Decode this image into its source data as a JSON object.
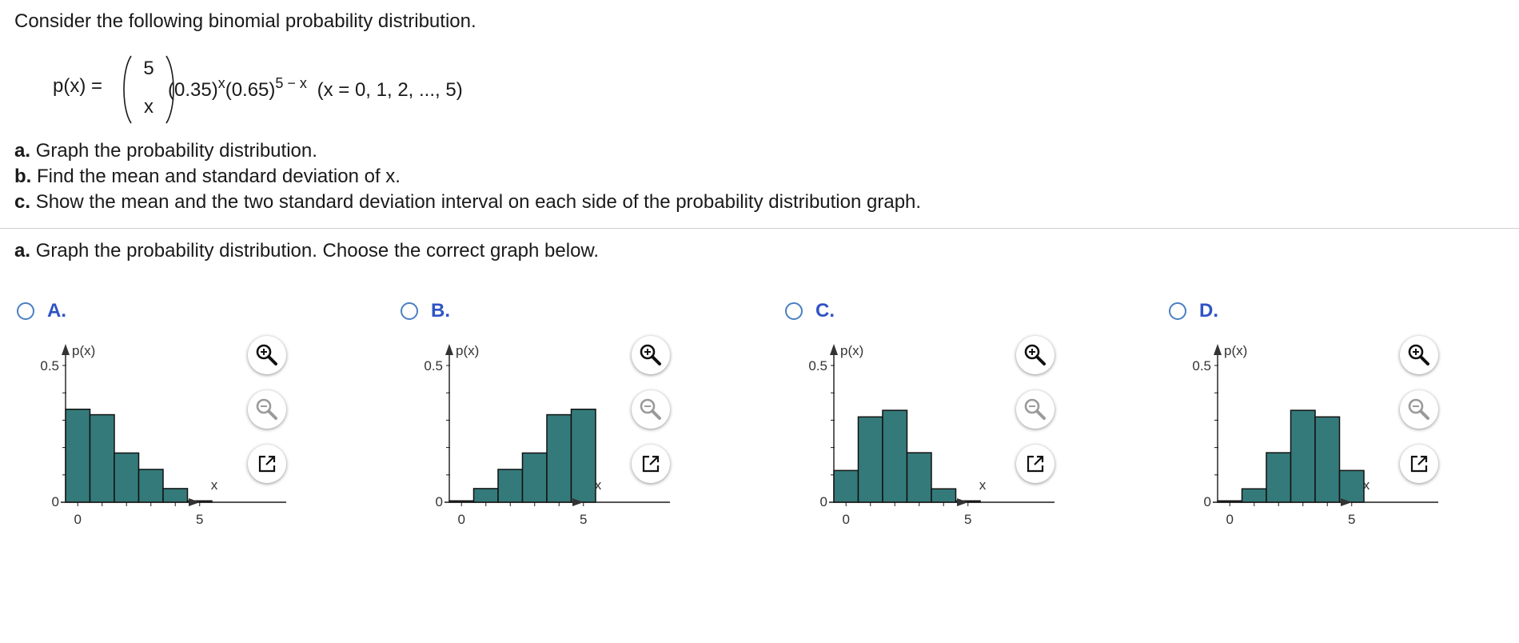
{
  "intro": "Consider the following binomial probability distribution.",
  "formula": {
    "lhs": "p(x) =",
    "binom_top": "5",
    "binom_bottom": "x",
    "p_base": "(0.35)",
    "p_exp": "x",
    "q_base": "(0.65)",
    "q_exp": "5 − x",
    "domain": "(x = 0, 1, 2, ..., 5)"
  },
  "parts": [
    {
      "letter": "a.",
      "text": "Graph the probability distribution."
    },
    {
      "letter": "b.",
      "text": "Find the mean and standard deviation of x."
    },
    {
      "letter": "c.",
      "text": "Show the mean and the two standard deviation interval on each side of the probability distribution graph."
    }
  ],
  "question": {
    "letter": "a.",
    "text": "Graph the probability distribution. Choose the correct graph below."
  },
  "colors": {
    "bar_fill": "#357a7a",
    "radio": "#4a7fc1",
    "option_letter": "#2f54c4"
  },
  "icons": {
    "zoom_in": "zoom-in-icon",
    "zoom_out": "zoom-out-icon",
    "popout": "popout-icon"
  },
  "options": [
    {
      "label": "A.",
      "ylabel": "p(x)",
      "xlabel": "x",
      "yticks": [
        "0",
        "0.5"
      ],
      "xticks": [
        "0",
        "5"
      ]
    },
    {
      "label": "B.",
      "ylabel": "p(x)",
      "xlabel": "x",
      "yticks": [
        "0",
        "0.5"
      ],
      "xticks": [
        "0",
        "5"
      ]
    },
    {
      "label": "C.",
      "ylabel": "p(x)",
      "xlabel": "x",
      "yticks": [
        "0",
        "0.5"
      ],
      "xticks": [
        "0",
        "5"
      ]
    },
    {
      "label": "D.",
      "ylabel": "p(x)",
      "xlabel": "x",
      "yticks": [
        "0",
        "0.5"
      ],
      "xticks": [
        "0",
        "5"
      ]
    }
  ],
  "chart_data": [
    {
      "type": "bar",
      "categories": [
        0,
        1,
        2,
        3,
        4,
        5
      ],
      "values": [
        0.34,
        0.32,
        0.18,
        0.12,
        0.05,
        0.005
      ],
      "ylim": [
        0,
        0.5
      ],
      "xlabel": "x",
      "ylabel": "p(x)"
    },
    {
      "type": "bar",
      "categories": [
        0,
        1,
        2,
        3,
        4,
        5
      ],
      "values": [
        0.005,
        0.05,
        0.12,
        0.18,
        0.32,
        0.34
      ],
      "ylim": [
        0,
        0.5
      ],
      "xlabel": "x",
      "ylabel": "p(x)"
    },
    {
      "type": "bar",
      "categories": [
        0,
        1,
        2,
        3,
        4,
        5
      ],
      "values": [
        0.116,
        0.312,
        0.336,
        0.181,
        0.049,
        0.005
      ],
      "ylim": [
        0,
        0.5
      ],
      "xlabel": "x",
      "ylabel": "p(x)"
    },
    {
      "type": "bar",
      "categories": [
        0,
        1,
        2,
        3,
        4,
        5
      ],
      "values": [
        0.005,
        0.049,
        0.181,
        0.336,
        0.312,
        0.116
      ],
      "ylim": [
        0,
        0.5
      ],
      "xlabel": "x",
      "ylabel": "p(x)"
    }
  ]
}
